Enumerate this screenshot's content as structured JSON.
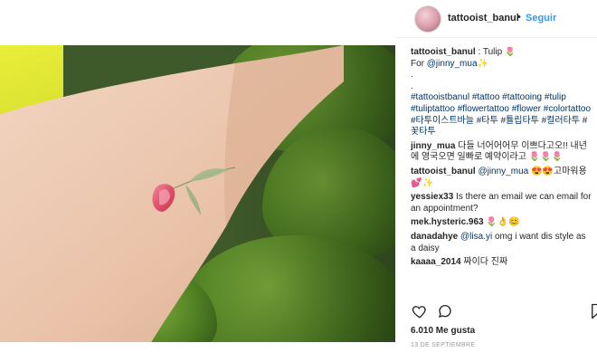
{
  "header": {
    "username": "tattooist_banul",
    "separator": "•",
    "follow_label": "Seguir"
  },
  "caption": {
    "username": "tattooist_banul",
    "text": " : Tulip ",
    "tulip_emoji": "🌷",
    "line2_prefix": "For ",
    "mention": "@jinny_mua",
    "line2_emoji": "✨",
    "dot1": ".",
    "dot2": ".",
    "hashtags": "#tattooistbanul #tattoo #tattooing #tulip #tuliptattoo #flowertattoo #flower #colortattoo #타투이스트바늘 #타투 #튤립타투 #컬러타투 #꽃타투"
  },
  "comments": [
    {
      "username": "jinny_mua",
      "text": " 다들 너어어어무 이쁘다고오!! 내년에 영국오면 일빠로 예약이라고 ",
      "emoji": "🌷🌷🌷"
    },
    {
      "username": "tattooist_banul",
      "mention": "@jinny_mua",
      "emoji": " 😍😍",
      "text": "고마워용 ",
      "emoji2": "💕✨"
    },
    {
      "username": "yessiex33",
      "text": " Is there an email we can email for an appointment?"
    },
    {
      "username": "mek.hysteric.963",
      "text": " ",
      "emoji": "🌷👌😊"
    },
    {
      "username": "danadahye",
      "mention": "@lisa.yi",
      "text": " omg i want dis style as a daisy"
    },
    {
      "username": "kaaaa_2014",
      "text": " 짜이다 진짜"
    }
  ],
  "actions": {
    "like_icon": "heart-outline-icon",
    "comment_icon": "comment-bubble-icon",
    "save_icon": "bookmark-icon"
  },
  "likes": "6.010 Me gusta",
  "date": "13 DE SEPTIEMBRE",
  "colors": {
    "link": "#003569",
    "follow": "#3897f0",
    "muted": "#999999"
  }
}
